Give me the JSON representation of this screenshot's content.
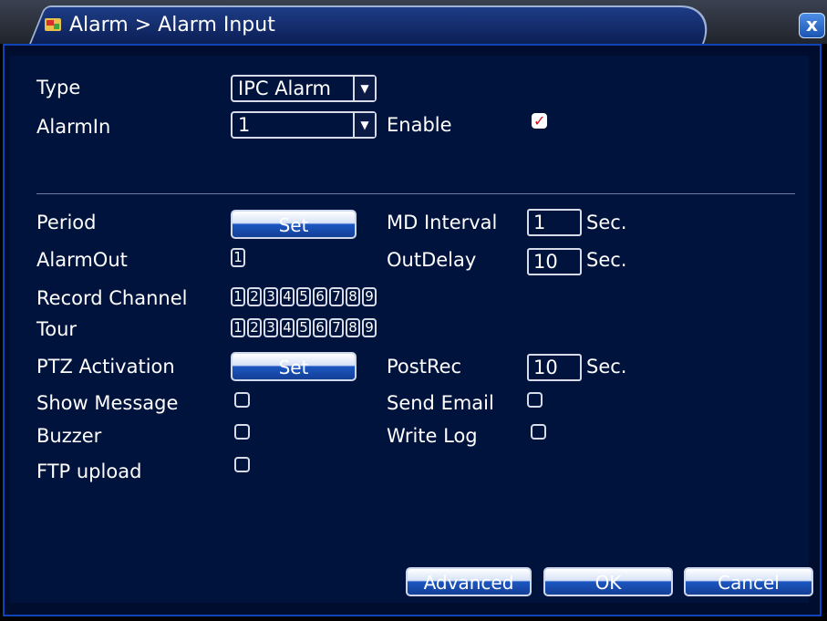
{
  "window": {
    "title": "Alarm > Alarm Input",
    "close_label": "x"
  },
  "form": {
    "type_label": "Type",
    "type_value": "IPC Alarm",
    "alarmin_label": "AlarmIn",
    "alarmin_value": "1",
    "enable_label": "Enable",
    "enable_checked": true,
    "period_label": "Period",
    "period_button": "Set",
    "md_interval_label": "MD Interval",
    "md_interval_value": "1",
    "md_interval_unit": "Sec.",
    "alarmout_label": "AlarmOut",
    "alarmout_channels": [
      "1"
    ],
    "outdelay_label": "OutDelay",
    "outdelay_value": "10",
    "outdelay_unit": "Sec.",
    "record_channel_label": "Record Channel",
    "record_channels": [
      "1",
      "2",
      "3",
      "4",
      "5",
      "6",
      "7",
      "8",
      "9"
    ],
    "tour_label": "Tour",
    "tour_channels": [
      "1",
      "2",
      "3",
      "4",
      "5",
      "6",
      "7",
      "8",
      "9"
    ],
    "ptz_label": "PTZ Activation",
    "ptz_button": "Set",
    "postrec_label": "PostRec",
    "postrec_value": "10",
    "postrec_unit": "Sec.",
    "show_message_label": "Show Message",
    "send_email_label": "Send Email",
    "buzzer_label": "Buzzer",
    "write_log_label": "Write Log",
    "ftp_upload_label": "FTP upload"
  },
  "footer": {
    "advanced": "Advanced",
    "ok": "OK",
    "cancel": "Cancel"
  },
  "colors": {
    "panel_bg": "#00133d",
    "border_blue": "#0d44b8",
    "check_red": "#d0101a"
  }
}
